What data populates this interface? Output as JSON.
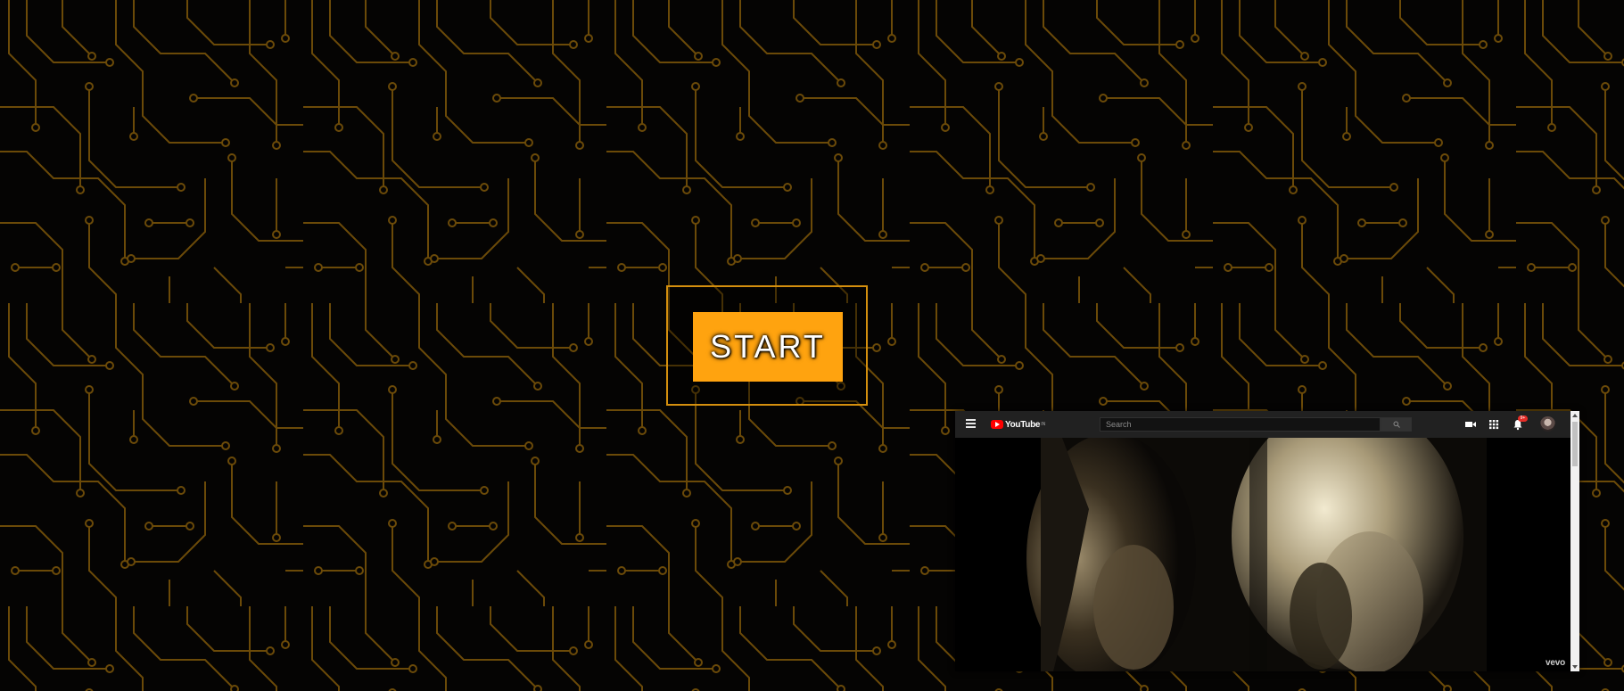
{
  "start_screen": {
    "start_label": "START",
    "accent_color": "#ffa30f",
    "frame_color": "#d48f0e",
    "circuit_color": "#6b4a08",
    "background_color": "#050403"
  },
  "youtube_popup": {
    "logo_text": "YouTube",
    "logo_region": "IN",
    "search_placeholder": "Search",
    "notification_count": "9+",
    "watermark": "vevo",
    "icons": [
      "menu-icon",
      "youtube-logo-icon",
      "search-icon",
      "video-camera-icon",
      "apps-grid-icon",
      "bell-icon",
      "avatar"
    ]
  }
}
